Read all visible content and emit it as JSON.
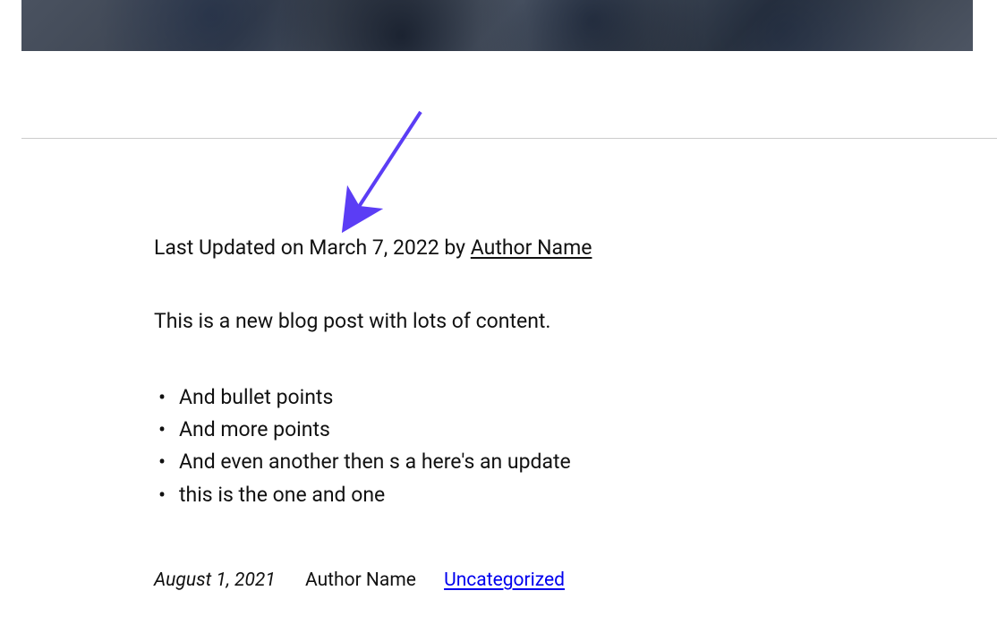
{
  "updated": {
    "prefix": "Last Updated on ",
    "date": "March 7, 2022",
    "by": " by ",
    "author": "Author Name"
  },
  "intro": "This is a new blog post with lots of content.",
  "bullets": [
    "And bullet points",
    "And more points",
    "And even another then s a here's an update",
    "this is the one and one"
  ],
  "meta": {
    "date": "August 1, 2021",
    "author": "Author Name",
    "category": "Uncategorized"
  },
  "colors": {
    "arrow": "#5b3df5"
  }
}
